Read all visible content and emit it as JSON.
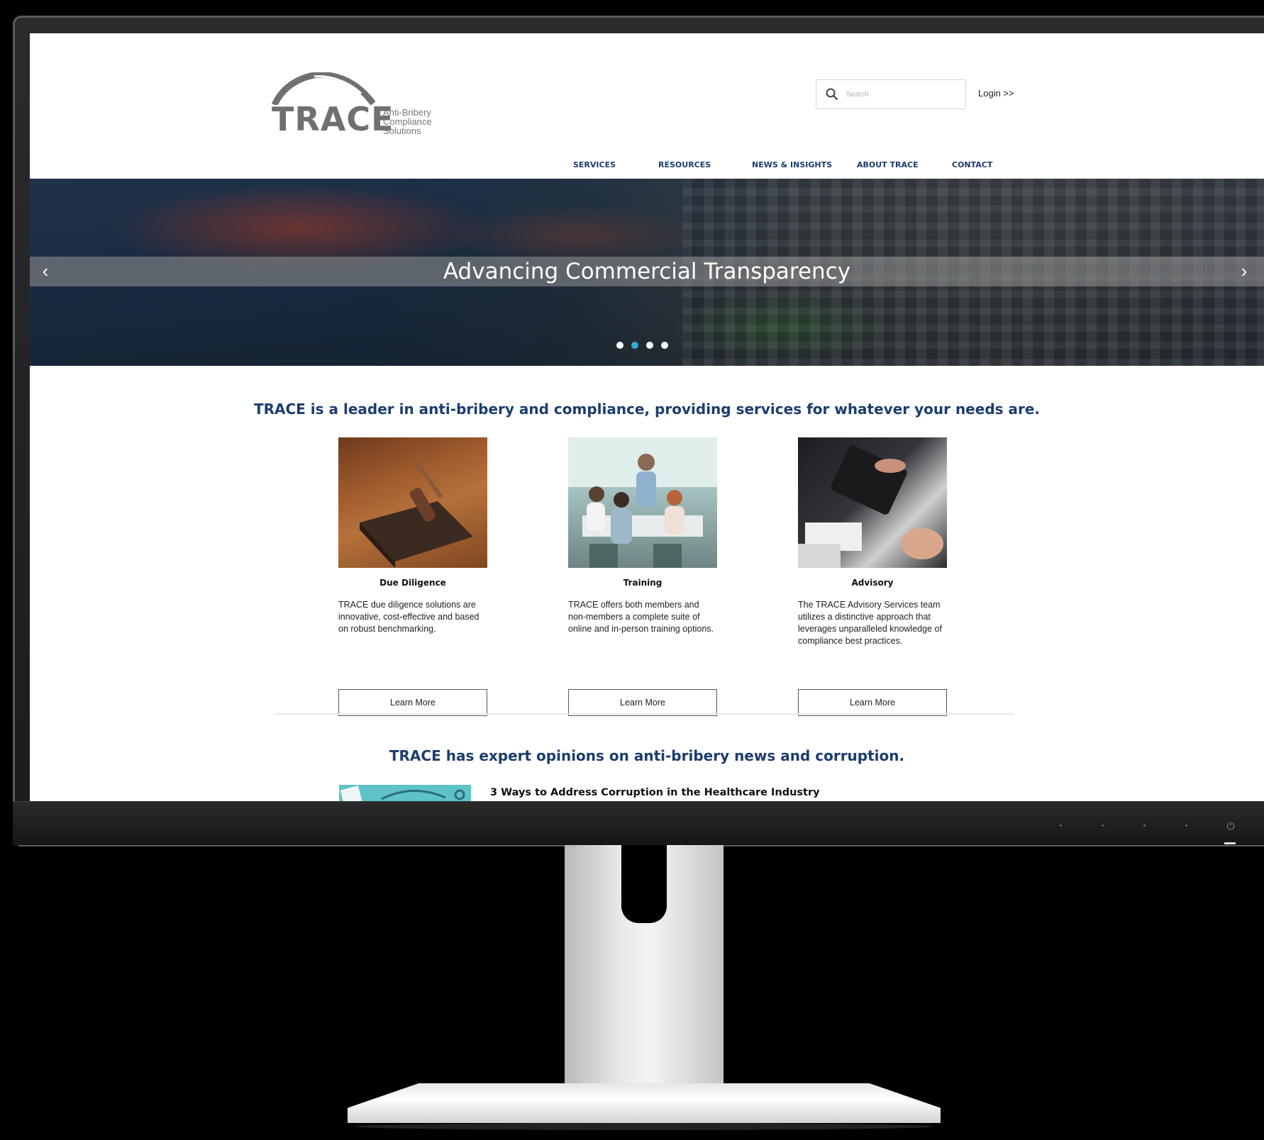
{
  "header": {
    "logo_word": "TRACE",
    "logo_tagline": [
      "Anti-Bribery",
      "Compliance",
      "Solutions"
    ],
    "search_placeholder": "Search",
    "login_label": "Login >>"
  },
  "nav": {
    "items": [
      "SERVICES",
      "RESOURCES",
      "NEWS & INSIGHTS",
      "ABOUT TRACE",
      "CONTACT"
    ]
  },
  "hero": {
    "title": "Advancing Commercial Transparency",
    "prev_icon": "‹",
    "next_icon": "›",
    "slide_count": 4,
    "active_slide": 2
  },
  "intro": {
    "heading": "TRACE is a leader in anti-bribery and compliance, providing services for whatever your needs are."
  },
  "services": [
    {
      "name": "Due Diligence",
      "description": "TRACE due diligence solutions are innovative, cost-effective and based on robust benchmarking.",
      "button": "Learn More"
    },
    {
      "name": "Training",
      "description": "TRACE offers both members and non-members a complete suite of online and in-person training options.",
      "button": "Learn More"
    },
    {
      "name": "Advisory",
      "description": "The TRACE Advisory Services team utilizes a distinctive approach that leverages unparalleled knowledge of compliance best practices.",
      "button": "Learn More"
    }
  ],
  "news": {
    "heading": "TRACE has expert opinions on anti-bribery news and corruption.",
    "first_article_title": "3 Ways to Address Corruption in the Healthcare Industry"
  },
  "colors": {
    "brand_navy": "#1c3d6e",
    "logo_gray": "#707070",
    "active_dot": "#33a9d6"
  }
}
